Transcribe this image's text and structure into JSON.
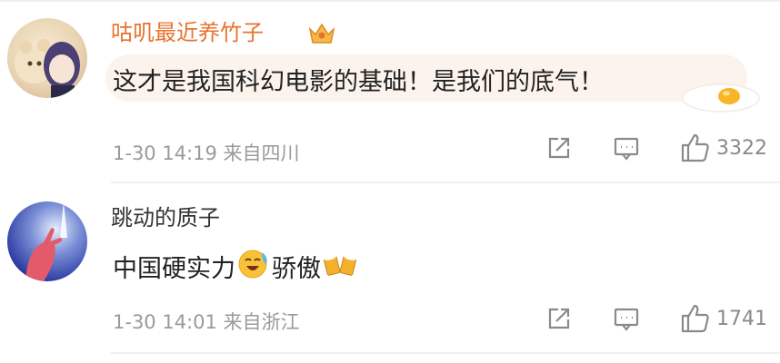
{
  "comments": [
    {
      "username": "咕叽最近养竹子",
      "text": "这才是我国科幻电影的基础！是我们的底气！",
      "time": "1-30 14:19",
      "location": "来自四川",
      "likes": "3322",
      "badge_icon": "crown-badge-icon",
      "sticker_icon": "fried-egg-icon"
    },
    {
      "username": "跳动的质子",
      "text_part1": "中国硬实力",
      "text_part2": "骄傲",
      "time": "1-30 14:01",
      "location": "来自浙江",
      "likes": "1741",
      "emojis": [
        "crying-laughing-emoji",
        "cheers-beer-emoji"
      ]
    }
  ],
  "colors": {
    "vip_name": "#e8732d",
    "name": "#333333",
    "meta": "#9a9a9a",
    "bubble": "#fbf3ec"
  }
}
